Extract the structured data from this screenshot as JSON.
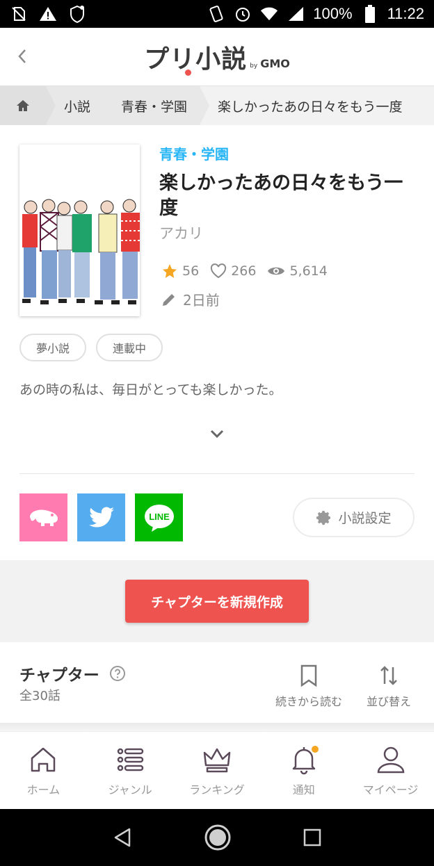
{
  "status_bar": {
    "battery": "100%",
    "time": "11:22"
  },
  "header": {
    "logo_main": "プリ小説",
    "logo_by": "by",
    "logo_brand": "GMO"
  },
  "breadcrumb": {
    "items": [
      "小説",
      "青春・学園",
      "楽しかったあの日々をもう一度"
    ]
  },
  "novel": {
    "genre": "青春・学園",
    "title": "楽しかったあの日々をもう一度",
    "author": "アカリ",
    "stars": "56",
    "likes": "266",
    "views": "5,614",
    "updated": "2日前",
    "tags": [
      "夢小説",
      "連載中"
    ],
    "synopsis": "あの時の私は、毎日がとっても楽しかった。",
    "settings_label": "小説設定"
  },
  "share": {
    "line_label": "LINE"
  },
  "create_chapter_label": "チャプターを新規作成",
  "chapters": {
    "heading": "チャプター",
    "count": "全30話",
    "resume_label": "続きから読む",
    "sort_label": "並び替え"
  },
  "bottom_nav": {
    "home": "ホーム",
    "genre": "ジャンル",
    "ranking": "ランキング",
    "notifications": "通知",
    "mypage": "マイページ"
  },
  "colors": {
    "accent_red": "#ef5350",
    "genre_blue": "#29b6f6",
    "star": "#f5a623"
  }
}
